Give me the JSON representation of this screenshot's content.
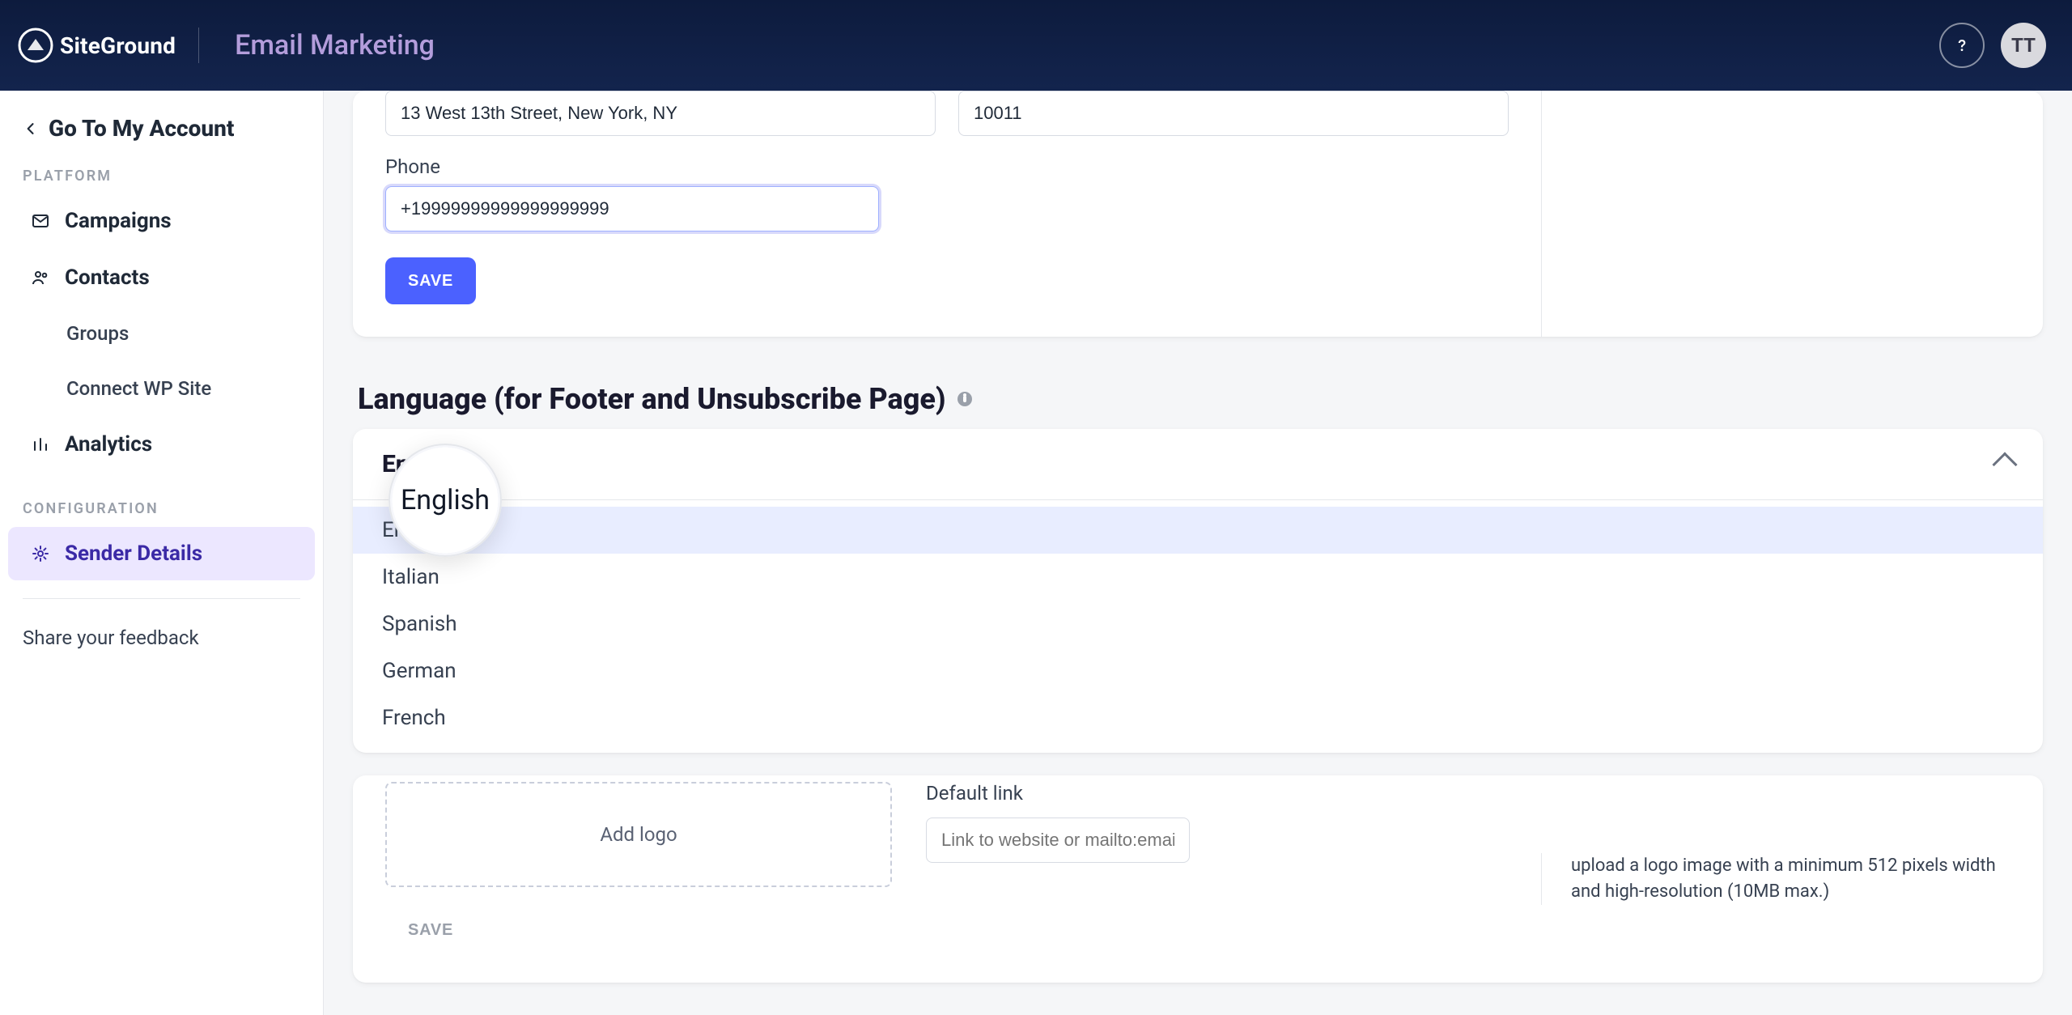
{
  "header": {
    "brand_wordmark": "SiteGround",
    "product": "Email Marketing",
    "avatar_initials": "TT"
  },
  "sidebar": {
    "back_label": "Go To My Account",
    "sections": {
      "platform": "PLATFORM",
      "configuration": "CONFIGURATION"
    },
    "items": {
      "campaigns": "Campaigns",
      "contacts": "Contacts",
      "groups": "Groups",
      "connect_wp": "Connect WP Site",
      "analytics": "Analytics",
      "sender_details": "Sender Details"
    },
    "feedback": "Share your feedback"
  },
  "sender_form": {
    "address_value": "13 West 13th Street, New York, NY",
    "secondary_value": "10011",
    "phone_label": "Phone",
    "phone_value": "+19999999999999999999",
    "save_label": "SAVE"
  },
  "language_section": {
    "title": "Language (for Footer and Unsubscribe Page)",
    "selected": "English",
    "options": [
      "English",
      "Italian",
      "Spanish",
      "German",
      "French"
    ],
    "lens_text": "English"
  },
  "logo_section": {
    "uploader_text": "Add logo",
    "default_link_label": "Default link",
    "default_link_placeholder": "Link to website or mailto:email@domain.com",
    "hint": "upload a logo image with a minimum 512 pixels width and high-resolution (10MB max.)",
    "save_label": "SAVE"
  },
  "colors": {
    "accent": "#4b61ff",
    "purple": "#7c3aed"
  }
}
